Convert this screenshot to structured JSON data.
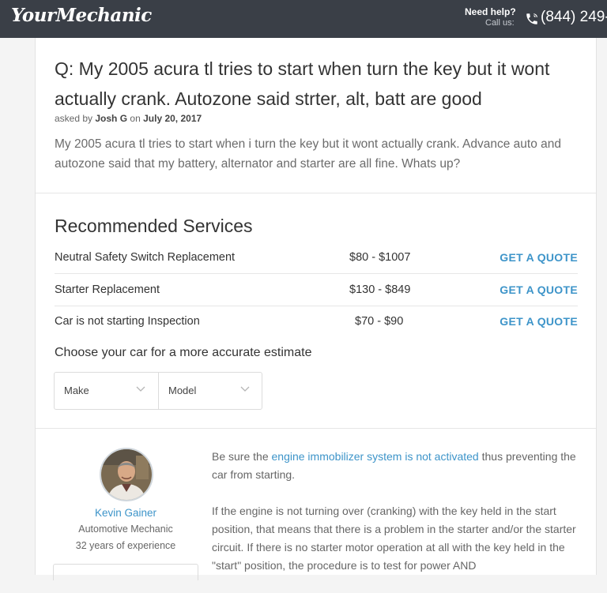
{
  "header": {
    "logo": "YourMechanic",
    "need_help": "Need help?",
    "call_us": "Call us:",
    "phone": "(844) 249-"
  },
  "question": {
    "title": "Q: My 2005 acura tl tries to start when turn the key but it wont actually crank. Autozone said strter, alt, batt are good",
    "asked_prefix": "asked by",
    "author": "Josh G",
    "on": "on",
    "date": "July 20, 2017",
    "body": "My 2005 acura tl tries to start when i turn the key but it wont actually crank. Advance auto and autozone said that my battery, alternator and starter are all fine. Whats up?"
  },
  "recommended": {
    "title": "Recommended Services",
    "services": [
      {
        "name": "Neutral Safety Switch Replacement",
        "price": "$80 - $1007",
        "cta": "GET A QUOTE"
      },
      {
        "name": "Starter Replacement",
        "price": "$130 - $849",
        "cta": "GET A QUOTE"
      },
      {
        "name": "Car is not starting Inspection",
        "price": "$70 - $90",
        "cta": "GET A QUOTE"
      }
    ],
    "choose_label": "Choose your car for a more accurate estimate",
    "make_placeholder": "Make",
    "model_placeholder": "Model"
  },
  "mechanic": {
    "name": "Kevin Gainer",
    "role": "Automotive Mechanic",
    "experience": "32 years of experience"
  },
  "answer": {
    "p1_before": "Be sure the ",
    "p1_link": "engine immobilizer system is not activated",
    "p1_after": " thus preventing the car from starting.",
    "p2": "If the engine is not turning over (cranking) with the key held in the start position, that means that there is a problem in the starter and/or the starter circuit. If there is no starter motor operation at all with the key held in the \"start\" position, the procedure is to test for power AND"
  },
  "colors": {
    "header_bg": "#3a3f47",
    "link": "#3d94c9"
  }
}
